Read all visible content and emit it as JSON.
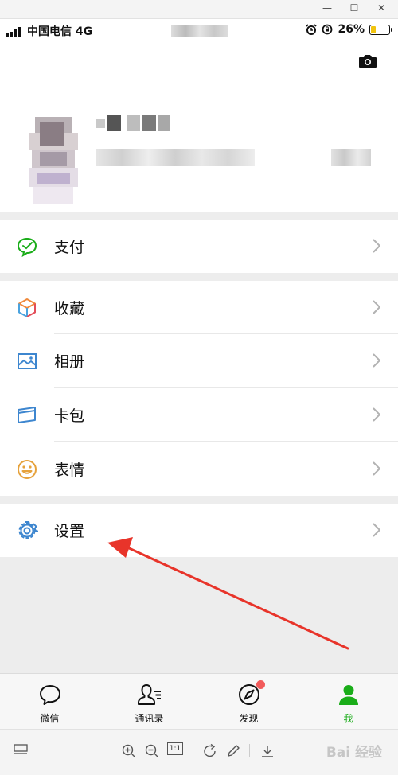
{
  "window": {
    "minimize_glyph": "—",
    "maximize_glyph": "☐",
    "close_glyph": "✕"
  },
  "status_bar": {
    "carrier": "中国电信 4G",
    "battery_percent": "26%",
    "battery_level": 0.26,
    "battery_color": "#f1c40f"
  },
  "menu": {
    "pay": "支付",
    "favorites": "收藏",
    "album": "相册",
    "cards": "卡包",
    "stickers": "表情",
    "settings": "设置"
  },
  "tabs": {
    "chats": "微信",
    "contacts": "通讯录",
    "discover": "发现",
    "me": "我"
  },
  "viewer_toolbar": {
    "ratio_label": "1:1",
    "watermark": "Bai 经验"
  },
  "colors": {
    "accent_green": "#1aad19",
    "annotation_arrow": "#e8342a",
    "badge_red": "#f25b5b"
  }
}
